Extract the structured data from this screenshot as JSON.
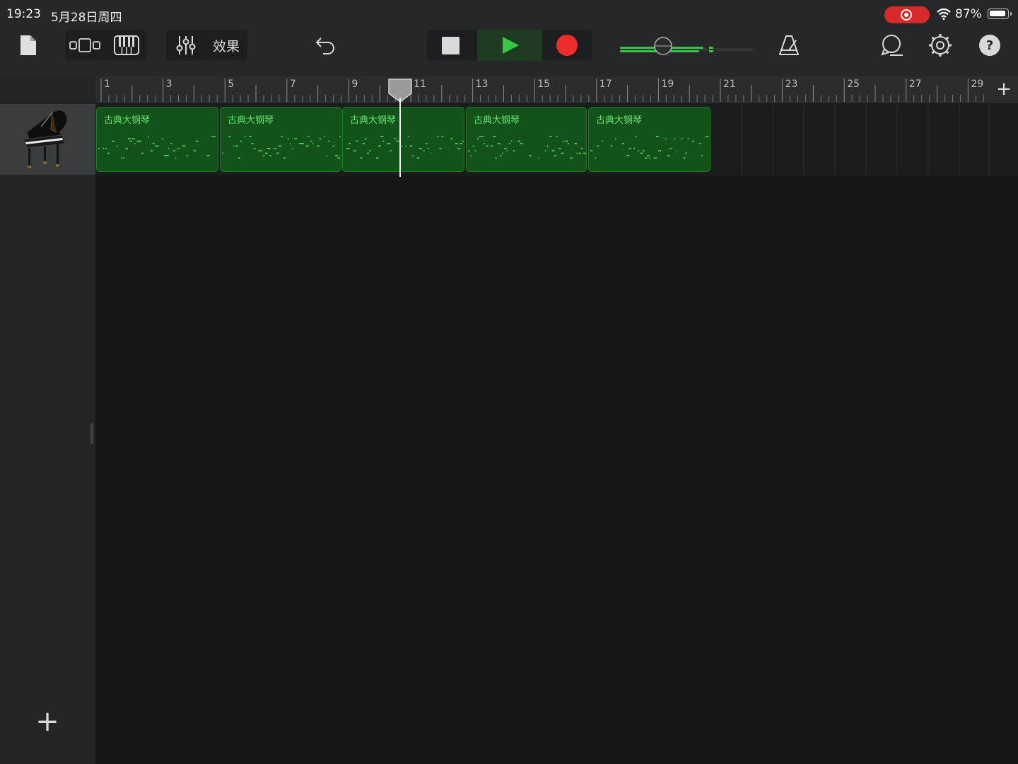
{
  "status_bar": {
    "time": "19:23",
    "date": "5月28日周四",
    "battery": "87%"
  },
  "toolbar": {
    "effects_label": "效果"
  },
  "ruler": {
    "bar_numbers": [
      "1",
      "3",
      "5",
      "7",
      "9",
      "11",
      "13",
      "15",
      "17",
      "19",
      "21",
      "23",
      "25",
      "27",
      "29"
    ]
  },
  "track": {
    "instrument_icon": "grand-piano-icon",
    "regions": [
      {
        "name": "古典大钢琴"
      },
      {
        "name": "古典大钢琴"
      },
      {
        "name": "古典大钢琴"
      },
      {
        "name": "古典大钢琴"
      },
      {
        "name": "古典大钢琴"
      }
    ]
  },
  "colors": {
    "accent_green": "#36c845",
    "region_green": "#14521c",
    "record_red": "#f02b2b"
  }
}
